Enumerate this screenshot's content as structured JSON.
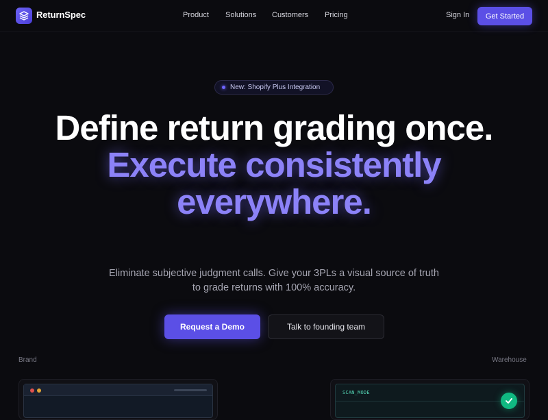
{
  "brand": {
    "name": "ReturnSpec",
    "accent": "#5b4fe6"
  },
  "nav": {
    "links": [
      "Product",
      "Solutions",
      "Customers",
      "Pricing"
    ],
    "sign_in": "Sign In",
    "cta": "Get Started"
  },
  "hero": {
    "badge": "New: Shopify Plus Integration",
    "headline_1": "Define return grading once.",
    "headline_2": "Execute consistently",
    "headline_3": "everywhere.",
    "subtitle_1": "Eliminate subjective judgment calls. Give your 3PLs a visual source of truth",
    "subtitle_2": "to grade returns with 100% accuracy.",
    "primary_cta": "Request a Demo",
    "secondary_cta": "Talk to founding team"
  },
  "panels": {
    "left_label": "Brand",
    "right_label": "Warehouse",
    "scan_mode": "SCAN_MODE"
  },
  "icons": {
    "logo": "layers-icon",
    "status": "checkmark-icon"
  }
}
